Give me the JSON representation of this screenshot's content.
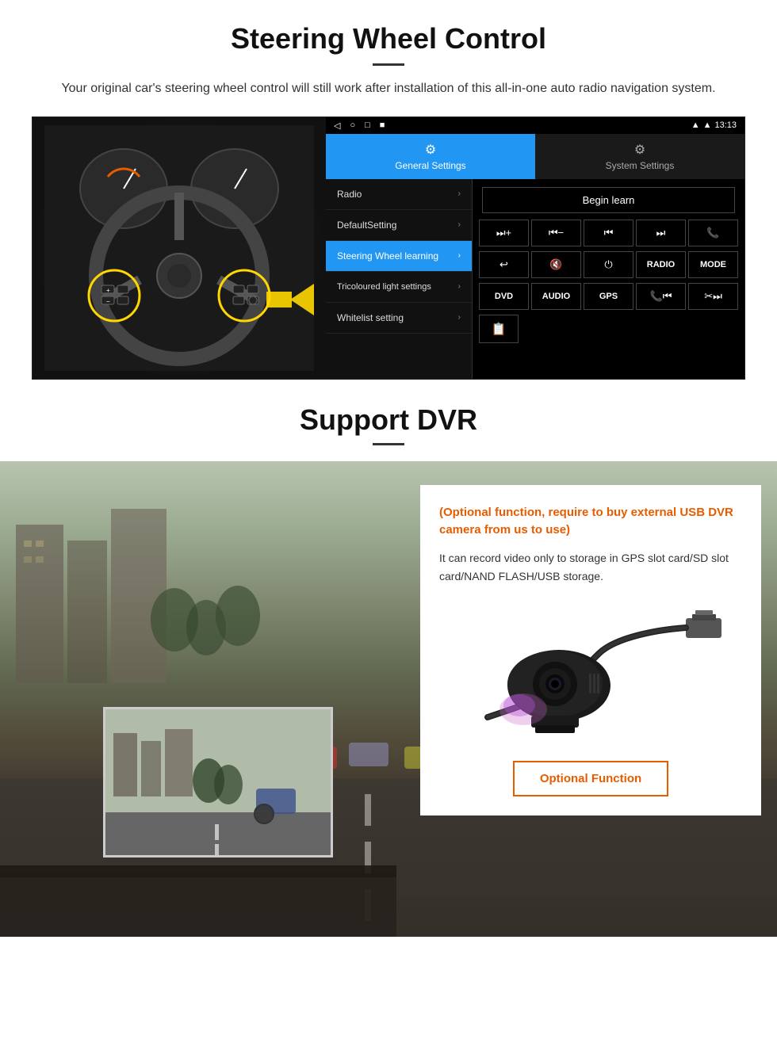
{
  "section1": {
    "title": "Steering Wheel Control",
    "subtitle": "Your original car's steering wheel control will still work after installation of this all-in-one auto radio navigation system.",
    "android": {
      "statusbar": {
        "time": "13:13",
        "icons": [
          "▼",
          "▲",
          "■"
        ]
      },
      "navicons": [
        "◁",
        "○",
        "□",
        "⬛"
      ],
      "tabs": [
        {
          "icon": "⚙",
          "label": "General Settings",
          "active": true
        },
        {
          "icon": "⚙",
          "label": "System Settings",
          "active": false
        }
      ],
      "menu_items": [
        {
          "label": "Radio",
          "active": false
        },
        {
          "label": "DefaultSetting",
          "active": false
        },
        {
          "label": "Steering Wheel learning",
          "active": true
        },
        {
          "label": "Tricoloured light settings",
          "active": false
        },
        {
          "label": "Whitelist setting",
          "active": false
        }
      ],
      "begin_learn": "Begin learn",
      "ctrl_buttons_row1": [
        {
          "symbol": "⏭+",
          "type": "icon"
        },
        {
          "symbol": "⏮−",
          "type": "icon"
        },
        {
          "symbol": "⏮⏮",
          "type": "icon"
        },
        {
          "symbol": "⏭⏭",
          "type": "icon"
        },
        {
          "symbol": "📞",
          "type": "icon"
        }
      ],
      "ctrl_buttons_row2": [
        {
          "symbol": "↩",
          "type": "icon"
        },
        {
          "symbol": "🔇×",
          "type": "icon"
        },
        {
          "symbol": "⏻",
          "type": "icon"
        },
        {
          "symbol": "RADIO",
          "type": "text"
        },
        {
          "symbol": "MODE",
          "type": "text"
        }
      ],
      "ctrl_buttons_row3": [
        {
          "symbol": "DVD",
          "type": "text"
        },
        {
          "symbol": "AUDIO",
          "type": "text"
        },
        {
          "symbol": "GPS",
          "type": "text"
        },
        {
          "symbol": "📞⏮",
          "type": "icon"
        },
        {
          "symbol": "✂⏭",
          "type": "icon"
        }
      ],
      "ctrl_bottom": "📋"
    }
  },
  "section2": {
    "title": "Support DVR",
    "info_card": {
      "optional_text": "(Optional function, require to buy external USB DVR camera from us to use)",
      "body_text": "It can record video only to storage in GPS slot card/SD slot card/NAND FLASH/USB storage.",
      "optional_btn": "Optional Function"
    }
  }
}
